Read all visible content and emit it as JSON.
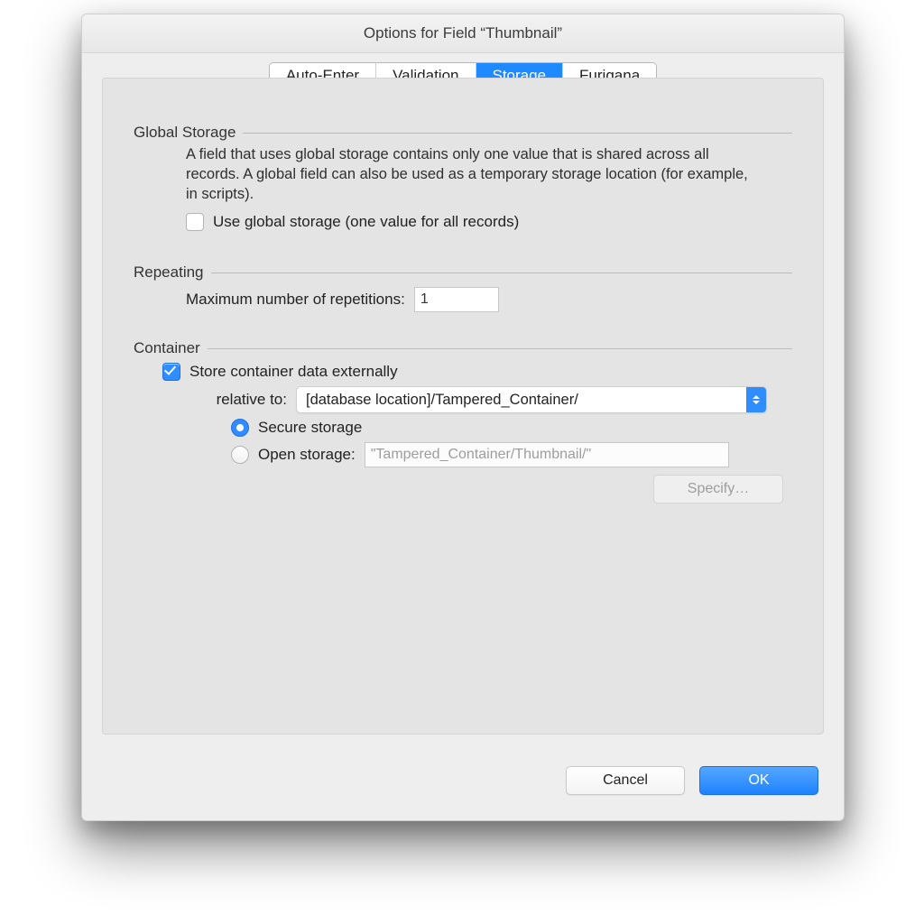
{
  "title": "Options for Field “Thumbnail”",
  "tabs": {
    "auto_enter": "Auto-Enter",
    "validation": "Validation",
    "storage": "Storage",
    "furigana": "Furigana",
    "selected": "storage"
  },
  "global_storage": {
    "heading": "Global Storage",
    "description": "A field that uses global storage contains only one value that is shared across all records.  A global field can also be used as a temporary storage location (for example, in scripts).",
    "checkbox_label": "Use global storage (one value for all records)",
    "checked": false
  },
  "repeating": {
    "heading": "Repeating",
    "label": "Maximum number of repetitions:",
    "value": "1"
  },
  "container": {
    "heading": "Container",
    "store_external_label": "Store container data externally",
    "store_external_checked": true,
    "relative_to_label": "relative to:",
    "relative_to_value": "[database location]/Tampered_Container/",
    "secure_label": "Secure storage",
    "open_label": "Open storage:",
    "open_value": "\"Tampered_Container/Thumbnail/\"",
    "storage_mode": "secure",
    "specify_label": "Specify…"
  },
  "buttons": {
    "cancel": "Cancel",
    "ok": "OK"
  }
}
